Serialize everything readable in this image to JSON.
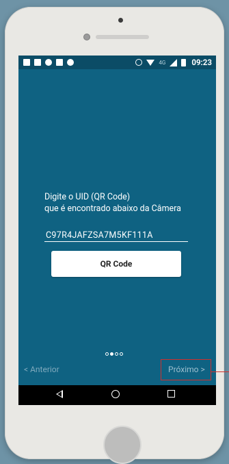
{
  "status_bar": {
    "network": "4G",
    "time": "09:23",
    "left_icons": [
      "facebook-icon",
      "image-icon",
      "fish-icon",
      "mail-icon",
      "android-icon"
    ],
    "right_icons": [
      "alarm-icon",
      "wifi-icon",
      "signal-icon",
      "battery-icon"
    ]
  },
  "instruction": {
    "line1": "Digite o UID (QR Code)",
    "line2": "que é encontrado abaixo da Câmera"
  },
  "uid_field": {
    "value": "C97R4JAFZSA7M5KF111A"
  },
  "qr_button": {
    "label": "QR Code"
  },
  "pager": {
    "total": 4,
    "active": 2
  },
  "nav": {
    "prev": "< Anterior",
    "next": "Próximo >"
  },
  "colors": {
    "screen_bg": "#0f6282",
    "status_bg": "#0b4c66",
    "highlight": "#d0302e"
  }
}
